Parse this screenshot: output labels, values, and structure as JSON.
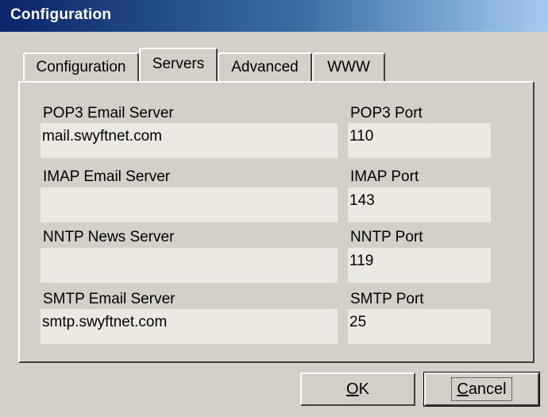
{
  "window": {
    "title": "Configuration"
  },
  "tabs": [
    {
      "label": "Configuration"
    },
    {
      "label": "Servers"
    },
    {
      "label": "Advanced"
    },
    {
      "label": "WWW"
    }
  ],
  "servers": {
    "pop3_server_label": "POP3 Email Server",
    "pop3_server_value": "mail.swyftnet.com",
    "pop3_port_label": "POP3 Port",
    "pop3_port_value": "110",
    "imap_server_label": "IMAP Email Server",
    "imap_server_value": "",
    "imap_port_label": "IMAP Port",
    "imap_port_value": "143",
    "nntp_server_label": "NNTP News Server",
    "nntp_server_value": "",
    "nntp_port_label": "NNTP Port",
    "nntp_port_value": "119",
    "smtp_server_label": "SMTP Email Server",
    "smtp_server_value": "smtp.swyftnet.com",
    "smtp_port_label": "SMTP Port",
    "smtp_port_value": "25"
  },
  "buttons": {
    "ok_mnemonic": "O",
    "ok_rest": "K",
    "cancel_mnemonic": "C",
    "cancel_rest": "ancel"
  },
  "colors": {
    "face": "#d4d0c8",
    "field": "#ece9e2",
    "title_start": "#0a246a",
    "title_end": "#a6caf0"
  }
}
